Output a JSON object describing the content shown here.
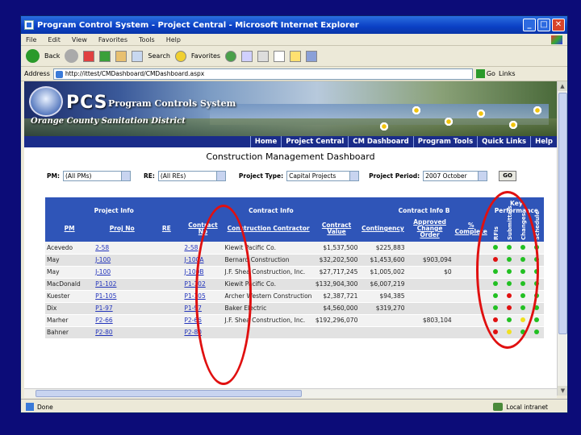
{
  "window": {
    "title": "Program Control System - Project Central - Microsoft Internet Explorer",
    "buttons": {
      "minimize": "_",
      "maximize": "□",
      "close": "✕"
    }
  },
  "menubar": [
    "File",
    "Edit",
    "View",
    "Favorites",
    "Tools",
    "Help"
  ],
  "toolbar": {
    "back": "Back",
    "search": "Search",
    "favorites": "Favorites"
  },
  "address": {
    "label": "Address",
    "url": "http://ittest/CMDashboard/CMDashboard.aspx",
    "go": "Go",
    "links": "Links"
  },
  "banner": {
    "logo": "PCS",
    "subtitle": "Program Controls System",
    "district": "Orange County Sanitation District"
  },
  "nav": [
    "Home",
    "Project Central",
    "CM Dashboard",
    "Program Tools",
    "Quick Links",
    "Help"
  ],
  "dashboard_title": "Construction Management Dashboard",
  "filters": {
    "pm_label": "PM:",
    "pm_value": "(All PMs)",
    "re_label": "RE:",
    "re_value": "(All REs)",
    "type_label": "Project Type:",
    "type_value": "Capital Projects",
    "period_label": "Project Period:",
    "period_value": "2007 October",
    "go": "GO"
  },
  "grid": {
    "group_headers": {
      "project_info": "Project Info",
      "contract_info": "Contract Info",
      "contract_info_b": "Contract Info B",
      "kpi": "Key Performance"
    },
    "columns": {
      "pm": "PM",
      "proj_no": "Proj No",
      "re": "RE",
      "contract_no": "Contract No",
      "contractor": "Construction Contractor",
      "contract_value": "Contract Value",
      "contingency": "Contingency",
      "approved_co": "Approved Change Order",
      "pct_complete": "% Complete",
      "k1": "RFIs",
      "k2": "Submittals",
      "k3": "Changes",
      "k4": "Schedule"
    },
    "rows": [
      {
        "pm": "Acevedo",
        "proj": "2-58",
        "re": "",
        "contract": "2-58",
        "contractor": "Kiewit Pacific Co.",
        "value": "$1,537,500",
        "cont": "$225,883",
        "aco": "",
        "pct": "",
        "k": [
          "green",
          "green",
          "green",
          "green"
        ]
      },
      {
        "pm": "May",
        "proj": "J-100",
        "re": "",
        "contract": "J-100A",
        "contractor": "Bernard Construction",
        "value": "$32,202,500",
        "cont": "$1,453,600",
        "aco": "$903,094",
        "pct": "",
        "k": [
          "red",
          "green",
          "green",
          "green"
        ]
      },
      {
        "pm": "May",
        "proj": "J-100",
        "re": "",
        "contract": "J-100B",
        "contractor": "J.F. Shea Construction, Inc.",
        "value": "$27,717,245",
        "cont": "$1,005,002",
        "aco": "$0",
        "pct": "",
        "k": [
          "green",
          "green",
          "green",
          "green"
        ]
      },
      {
        "pm": "MacDonald",
        "proj": "P1-102",
        "re": "",
        "contract": "P1-102",
        "contractor": "Kiewit Pacific Co.",
        "value": "$132,904,300",
        "cont": "$6,007,219",
        "aco": "",
        "pct": "",
        "k": [
          "green",
          "green",
          "green",
          "green"
        ]
      },
      {
        "pm": "Kuester",
        "proj": "P1-105",
        "re": "",
        "contract": "P1-105",
        "contractor": "Archer Western Construction",
        "value": "$2,387,721",
        "cont": "$94,385",
        "aco": "",
        "pct": "",
        "k": [
          "green",
          "red",
          "green",
          "green"
        ]
      },
      {
        "pm": "Dix",
        "proj": "P1-97",
        "re": "",
        "contract": "P1-97",
        "contractor": "Baker Electric",
        "value": "$4,560,000",
        "cont": "$319,270",
        "aco": "",
        "pct": "",
        "k": [
          "green",
          "red",
          "green",
          "green"
        ]
      },
      {
        "pm": "Marher",
        "proj": "P2-66",
        "re": "",
        "contract": "P2-66",
        "contractor": "J.F. Shea Construction, Inc.",
        "value": "$192,296,070",
        "cont": "",
        "aco": "$803,104",
        "pct": "",
        "k": [
          "red",
          "green",
          "yellow",
          "green"
        ]
      },
      {
        "pm": "Bahner",
        "proj": "P2-80",
        "re": "",
        "contract": "P2-80",
        "contractor": "",
        "value": "",
        "cont": "",
        "aco": "",
        "pct": "",
        "k": [
          "red",
          "yellow",
          "green",
          "green"
        ]
      }
    ]
  },
  "statusbar": {
    "left": "Done",
    "right": "Local intranet"
  },
  "colors": {
    "red": "#e01010",
    "green": "#22c022",
    "yellow": "#f0e020",
    "header": "#2f55b8",
    "nav": "#1a2c8a"
  }
}
